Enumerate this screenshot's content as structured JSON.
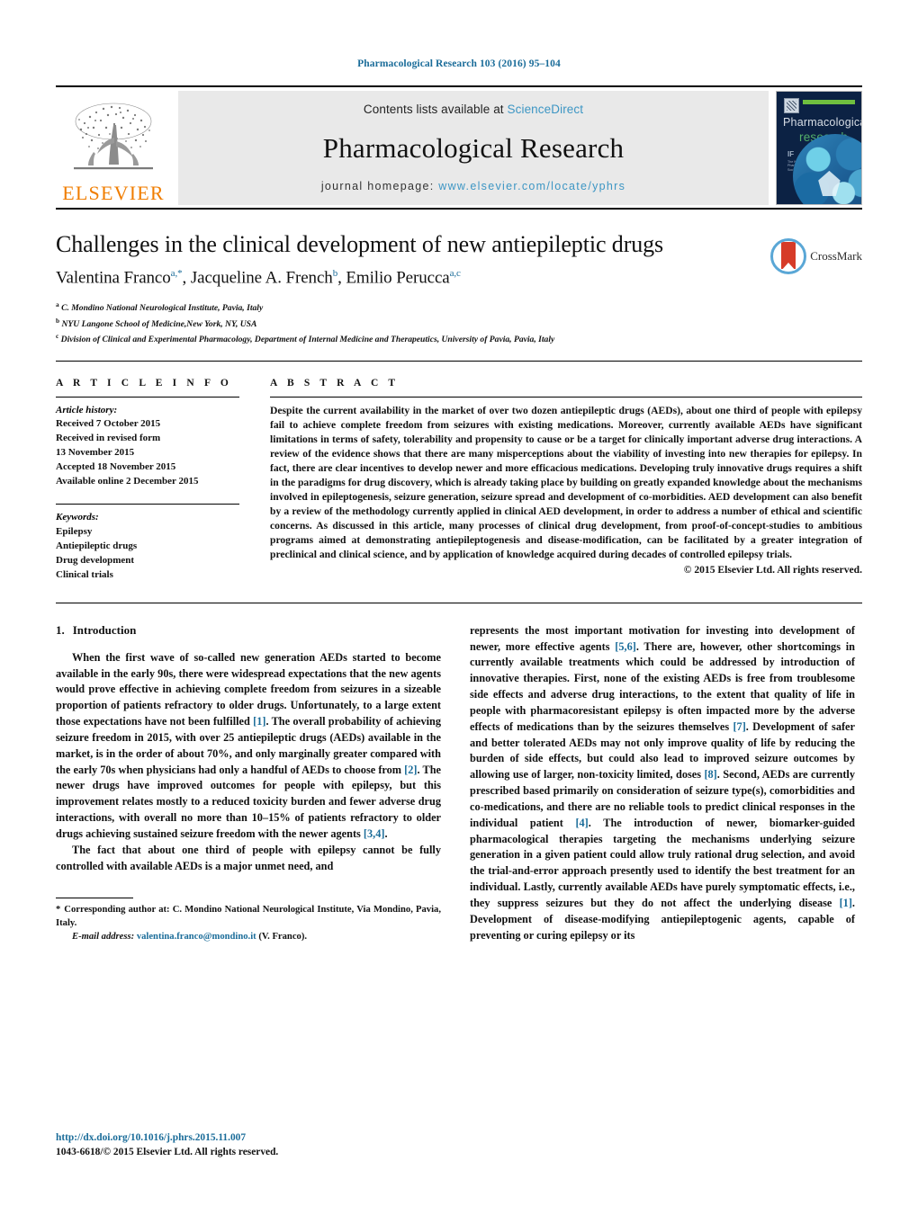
{
  "running_head": "Pharmacological Research 103 (2016) 95–104",
  "masthead": {
    "contents_prefix": "Contents lists available at ",
    "sciencedirect": "ScienceDirect",
    "journal_title": "Pharmacological Research",
    "homepage_prefix": "journal homepage: ",
    "homepage_url": "www.elsevier.com/locate/yphrs",
    "publisher_wordmark": "ELSEVIER",
    "cover": {
      "line1": "Pharmacological",
      "line2": "research",
      "society_mark": "IF",
      "society_text": "The Italian Pharmacological Society"
    },
    "colors": {
      "link": "#3d96c4",
      "elsevier_orange": "#f07d00",
      "cover_bg": "#0c2244",
      "cover_accent": "#54b06a",
      "panel_bg": "#e9e9e9"
    }
  },
  "article": {
    "title": "Challenges in the clinical development of new antiepileptic drugs",
    "authors_html": "Valentina Franco, Jacqueline A. French, Emilio Perucca",
    "authors": [
      {
        "name": "Valentina Franco",
        "marks": "a,*"
      },
      {
        "name": "Jacqueline A. French",
        "marks": "b"
      },
      {
        "name": "Emilio Perucca",
        "marks": "a,c"
      }
    ],
    "affiliations": [
      {
        "mark": "a",
        "text": "C. Mondino National Neurological Institute, Pavia, Italy"
      },
      {
        "mark": "b",
        "text": "NYU Langone School of Medicine,New York, NY, USA"
      },
      {
        "mark": "c",
        "text": "Division of Clinical and Experimental Pharmacology, Department of Internal Medicine and Therapeutics, University of Pavia, Pavia, Italy"
      }
    ],
    "crossmark_label": "CrossMark"
  },
  "article_info": {
    "heading": "A R T I C L E   I N F O",
    "history_label": "Article history:",
    "history": [
      "Received 7 October 2015",
      "Received in revised form",
      "13 November 2015",
      "Accepted 18 November 2015",
      "Available online 2 December 2015"
    ],
    "keywords_label": "Keywords:",
    "keywords": [
      "Epilepsy",
      "Antiepileptic drugs",
      "Drug development",
      "Clinical trials"
    ]
  },
  "abstract": {
    "heading": "A B S T R A C T",
    "text": "Despite the current availability in the market of over two dozen antiepileptic drugs (AEDs), about one third of people with epilepsy fail to achieve complete freedom from seizures with existing medications. Moreover, currently available AEDs have significant limitations in terms of safety, tolerability and propensity to cause or be a target for clinically important adverse drug interactions. A review of the evidence shows that there are many misperceptions about the viability of investing into new therapies for epilepsy. In fact, there are clear incentives to develop newer and more efficacious medications. Developing truly innovative drugs requires a shift in the paradigms for drug discovery, which is already taking place by building on greatly expanded knowledge about the mechanisms involved in epileptogenesis, seizure generation, seizure spread and development of co-morbidities. AED development can also benefit by a review of the methodology currently applied in clinical AED development, in order to address a number of ethical and scientific concerns. As discussed in this article, many processes of clinical drug development, from proof-of-concept-studies to ambitious programs aimed at demonstrating antiepileptogenesis and disease-modification, can be facilitated by a greater integration of preclinical and clinical science, and by application of knowledge acquired during decades of controlled epilepsy trials.",
    "copyright": "© 2015 Elsevier Ltd. All rights reserved."
  },
  "body": {
    "section_number": "1.",
    "section_title": "Introduction",
    "left_paragraph_1_a": "When the first wave of so-called new generation AEDs started to become available in the early 90s, there were widespread expectations that the new agents would prove effective in achieving complete freedom from seizures in a sizeable proportion of patients refractory to older drugs. Unfortunately, to a large extent those expectations have not been fulfilled ",
    "ref1": "[1]",
    "left_paragraph_1_b": ". The overall probability of achieving seizure freedom in 2015, with over 25 antiepileptic drugs (AEDs) available in the market, is in the order of about 70%, and only marginally greater compared with the early 70s when physicians had only a handful of AEDs to choose from ",
    "ref2": "[2]",
    "left_paragraph_1_c": ". The newer drugs have improved outcomes for people with epilepsy, but this improvement relates mostly to a reduced toxicity burden and fewer adverse drug interactions, with overall no more than 10–15% of patients refractory to older drugs achieving sustained seizure freedom with the newer agents ",
    "ref34": "[3,4]",
    "left_paragraph_1_d": ".",
    "left_paragraph_2": "The fact that about one third of people with epilepsy cannot be fully controlled with available AEDs is a major unmet need, and",
    "right_paragraph_a": "represents the most important motivation for investing into development of newer, more effective agents ",
    "ref56": "[5,6]",
    "right_paragraph_b": ". There are, however, other shortcomings in currently available treatments which could be addressed by introduction of innovative therapies. First, none of the existing AEDs is free from troublesome side effects and adverse drug interactions, to the extent that quality of life in people with pharmacoresistant epilepsy is often impacted more by the adverse effects of medications than by the seizures themselves ",
    "ref7": "[7]",
    "right_paragraph_c": ". Development of safer and better tolerated AEDs may not only improve quality of life by reducing the burden of side effects, but could also lead to improved seizure outcomes by allowing use of larger, non-toxicity limited, doses ",
    "ref8": "[8]",
    "right_paragraph_d": ". Second, AEDs are currently prescribed based primarily on consideration of seizure type(s), comorbidities and co-medications, and there are no reliable tools to predict clinical responses in the individual patient ",
    "ref4": "[4]",
    "right_paragraph_e": ". The introduction of newer, biomarker-guided pharmacological therapies targeting the mechanisms underlying seizure generation in a given patient could allow truly rational drug selection, and avoid the trial-and-error approach presently used to identify the best treatment for an individual. Lastly, currently available AEDs have purely symptomatic effects, i.e., they suppress seizures but they do not affect the underlying disease ",
    "ref1b": "[1]",
    "right_paragraph_f": ". Development of disease-modifying antiepileptogenic agents, capable of preventing or curing epilepsy or its"
  },
  "footnote": {
    "star": "*",
    "text": "Corresponding author at: C. Mondino National Neurological Institute, Via Mondino, Pavia, Italy.",
    "email_label": "E-mail address:",
    "email": "valentina.franco@mondino.it",
    "email_suffix": "(V. Franco)."
  },
  "imprint": {
    "doi": "http://dx.doi.org/10.1016/j.phrs.2015.11.007",
    "issn_line": "1043-6618/© 2015 Elsevier Ltd. All rights reserved."
  }
}
